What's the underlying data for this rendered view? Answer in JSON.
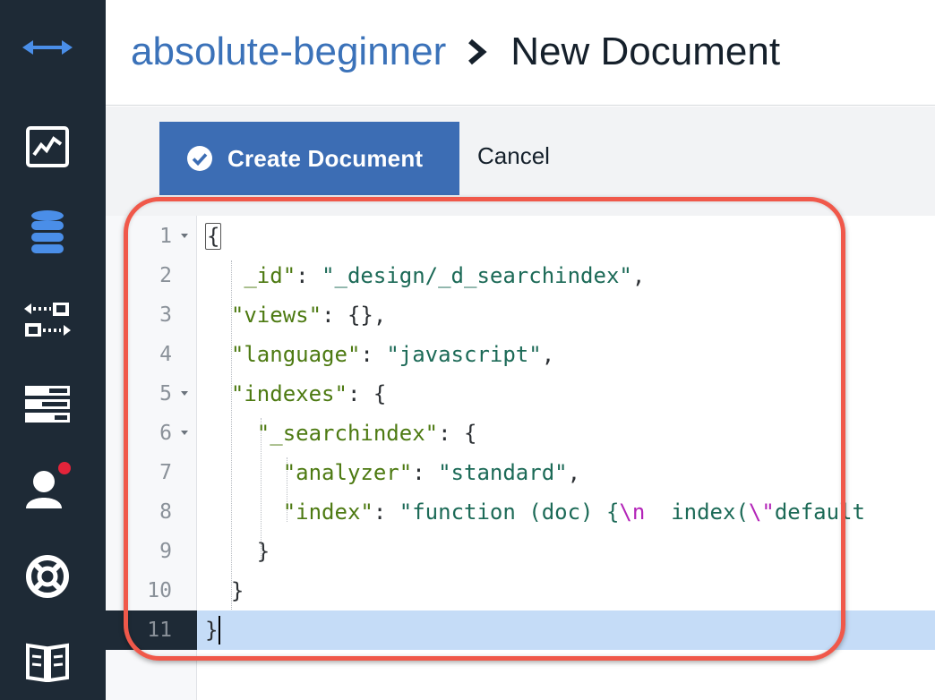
{
  "sidebar": {
    "items": [
      {
        "icon": "expand-arrows-icon"
      },
      {
        "icon": "monitoring-chart-icon"
      },
      {
        "icon": "database-icon"
      },
      {
        "icon": "replication-icon"
      },
      {
        "icon": "active-tasks-icon"
      },
      {
        "icon": "account-icon",
        "has_notification": true
      },
      {
        "icon": "support-lifebuoy-icon"
      },
      {
        "icon": "documentation-book-icon"
      }
    ],
    "colors": {
      "background": "#1e2a36",
      "active": "#4a8ee8",
      "icon": "#ffffff",
      "notification": "#e3243a"
    }
  },
  "header": {
    "database": "absolute-beginner",
    "page_title": "New Document"
  },
  "toolbar": {
    "create_label": "Create Document",
    "cancel_label": "Cancel"
  },
  "editor": {
    "line_numbers": [
      "1",
      "2",
      "3",
      "4",
      "5",
      "6",
      "7",
      "8",
      "9",
      "10",
      "11"
    ],
    "active_line": "11"
  }
}
